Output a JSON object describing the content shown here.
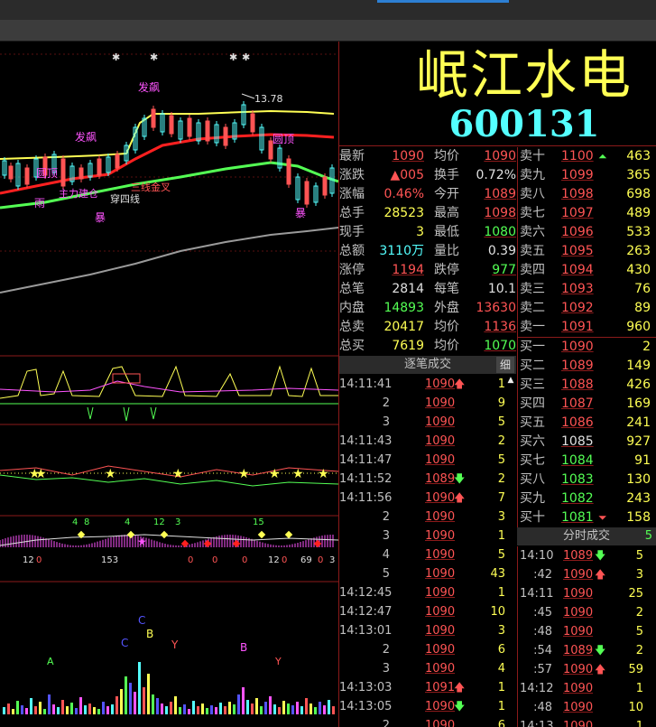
{
  "colors": {
    "up": "#ff5454",
    "down": "#54ff54",
    "volume": "#ffff54",
    "name": "#ffff54",
    "code": "#54ffff",
    "grid": "#8b1a1a"
  },
  "stock": {
    "name": "岷江水电",
    "code": "600131"
  },
  "quote": {
    "rows": [
      {
        "l1": "最新",
        "v1": "1090",
        "c1": "red",
        "u1": true,
        "l2": "均价",
        "v2": "1090",
        "c2": "red",
        "u2": true
      },
      {
        "l1": "涨跌",
        "v1": "▲005",
        "c1": "red",
        "u1": false,
        "l2": "换手",
        "v2": "0.72%",
        "c2": "white",
        "u2": false
      },
      {
        "l1": "涨幅",
        "v1": "0.46%",
        "c1": "red",
        "u1": false,
        "l2": "今开",
        "v2": "1089",
        "c2": "red",
        "u2": true
      },
      {
        "l1": "总手",
        "v1": "28523",
        "c1": "yellow",
        "u1": false,
        "l2": "最高",
        "v2": "1098",
        "c2": "red",
        "u2": true
      },
      {
        "l1": "现手",
        "v1": "3",
        "c1": "yellow",
        "u1": false,
        "l2": "最低",
        "v2": "1080",
        "c2": "green",
        "u2": true
      },
      {
        "l1": "总额",
        "v1": "3110万",
        "c1": "cyan",
        "u1": false,
        "l2": "量比",
        "v2": "0.39",
        "c2": "white",
        "u2": false
      },
      {
        "l1": "涨停",
        "v1": "1194",
        "c1": "red",
        "u1": true,
        "l2": "跌停",
        "v2": "977",
        "c2": "green",
        "u2": true
      },
      {
        "l1": "总笔",
        "v1": "2814",
        "c1": "white",
        "u1": false,
        "l2": "每笔",
        "v2": "10.1",
        "c2": "white",
        "u2": false
      },
      {
        "l1": "内盘",
        "v1": "14893",
        "c1": "green",
        "u1": false,
        "l2": "外盘",
        "v2": "13630",
        "c2": "red",
        "u2": false
      },
      {
        "l1": "总卖",
        "v1": "20417",
        "c1": "yellow",
        "u1": false,
        "l2": "均价",
        "v2": "1136",
        "c2": "red",
        "u2": true
      },
      {
        "l1": "总买",
        "v1": "7619",
        "c1": "yellow",
        "u1": false,
        "l2": "均价",
        "v2": "1070",
        "c2": "green",
        "u2": true
      }
    ]
  },
  "order_book": {
    "asks": [
      {
        "label": "卖十",
        "price": "1100",
        "color": "red",
        "arrow": "⏶",
        "arrow_color": "green",
        "vol": "463"
      },
      {
        "label": "卖九",
        "price": "1099",
        "color": "red",
        "arrow": "",
        "arrow_color": "",
        "vol": "365"
      },
      {
        "label": "卖八",
        "price": "1098",
        "color": "red",
        "arrow": "",
        "arrow_color": "",
        "vol": "698"
      },
      {
        "label": "卖七",
        "price": "1097",
        "color": "red",
        "arrow": "",
        "arrow_color": "",
        "vol": "489"
      },
      {
        "label": "卖六",
        "price": "1096",
        "color": "red",
        "arrow": "",
        "arrow_color": "",
        "vol": "533"
      },
      {
        "label": "卖五",
        "price": "1095",
        "color": "red",
        "arrow": "",
        "arrow_color": "",
        "vol": "263"
      },
      {
        "label": "卖四",
        "price": "1094",
        "color": "red",
        "arrow": "",
        "arrow_color": "",
        "vol": "430"
      },
      {
        "label": "卖三",
        "price": "1093",
        "color": "red",
        "arrow": "",
        "arrow_color": "",
        "vol": "76"
      },
      {
        "label": "卖二",
        "price": "1092",
        "color": "red",
        "arrow": "",
        "arrow_color": "",
        "vol": "89"
      },
      {
        "label": "卖一",
        "price": "1091",
        "color": "red",
        "arrow": "",
        "arrow_color": "",
        "vol": "960"
      }
    ],
    "bids": [
      {
        "label": "买一",
        "price": "1090",
        "color": "red",
        "arrow": "",
        "arrow_color": "",
        "vol": "2"
      },
      {
        "label": "买二",
        "price": "1089",
        "color": "red",
        "arrow": "",
        "arrow_color": "",
        "vol": "149"
      },
      {
        "label": "买三",
        "price": "1088",
        "color": "red",
        "arrow": "",
        "arrow_color": "",
        "vol": "426"
      },
      {
        "label": "买四",
        "price": "1087",
        "color": "red",
        "arrow": "",
        "arrow_color": "",
        "vol": "169"
      },
      {
        "label": "买五",
        "price": "1086",
        "color": "red",
        "arrow": "",
        "arrow_color": "",
        "vol": "241"
      },
      {
        "label": "买六",
        "price": "1085",
        "color": "white",
        "arrow": "",
        "arrow_color": "",
        "vol": "927"
      },
      {
        "label": "买七",
        "price": "1084",
        "color": "green",
        "arrow": "",
        "arrow_color": "",
        "vol": "91"
      },
      {
        "label": "买八",
        "price": "1083",
        "color": "green",
        "arrow": "",
        "arrow_color": "",
        "vol": "130"
      },
      {
        "label": "买九",
        "price": "1082",
        "color": "green",
        "arrow": "",
        "arrow_color": "",
        "vol": "243"
      },
      {
        "label": "买十",
        "price": "1081",
        "color": "green",
        "arrow": "⏷",
        "arrow_color": "red",
        "vol": "158"
      }
    ]
  },
  "tick_section": {
    "title": "逐笔成交",
    "detail_label": "细"
  },
  "ticks": [
    {
      "time": "14:11:41",
      "short": false,
      "price": "1090",
      "arrow": "🡅",
      "arrow_color": "red",
      "vol": "1"
    },
    {
      "time": "2",
      "short": true,
      "price": "1090",
      "arrow": "",
      "arrow_color": "",
      "vol": "9"
    },
    {
      "time": "3",
      "short": true,
      "price": "1090",
      "arrow": "",
      "arrow_color": "",
      "vol": "5"
    },
    {
      "time": "14:11:43",
      "short": false,
      "price": "1090",
      "arrow": "",
      "arrow_color": "",
      "vol": "2"
    },
    {
      "time": "14:11:47",
      "short": false,
      "price": "1090",
      "arrow": "",
      "arrow_color": "",
      "vol": "5"
    },
    {
      "time": "14:11:52",
      "short": false,
      "price": "1089",
      "arrow": "🡇",
      "arrow_color": "green",
      "vol": "2"
    },
    {
      "time": "14:11:56",
      "short": false,
      "price": "1090",
      "arrow": "🡅",
      "arrow_color": "red",
      "vol": "7"
    },
    {
      "time": "2",
      "short": true,
      "price": "1090",
      "arrow": "",
      "arrow_color": "",
      "vol": "3"
    },
    {
      "time": "3",
      "short": true,
      "price": "1090",
      "arrow": "",
      "arrow_color": "",
      "vol": "1"
    },
    {
      "time": "4",
      "short": true,
      "price": "1090",
      "arrow": "",
      "arrow_color": "",
      "vol": "5"
    },
    {
      "time": "5",
      "short": true,
      "price": "1090",
      "arrow": "",
      "arrow_color": "",
      "vol": "43"
    },
    {
      "time": "14:12:45",
      "short": false,
      "price": "1090",
      "arrow": "",
      "arrow_color": "",
      "vol": "1"
    },
    {
      "time": "14:12:47",
      "short": false,
      "price": "1090",
      "arrow": "",
      "arrow_color": "",
      "vol": "10"
    },
    {
      "time": "14:13:01",
      "short": false,
      "price": "1090",
      "arrow": "",
      "arrow_color": "",
      "vol": "3"
    },
    {
      "time": "2",
      "short": true,
      "price": "1090",
      "arrow": "",
      "arrow_color": "",
      "vol": "6"
    },
    {
      "time": "3",
      "short": true,
      "price": "1090",
      "arrow": "",
      "arrow_color": "",
      "vol": "4"
    },
    {
      "time": "14:13:03",
      "short": false,
      "price": "1091",
      "arrow": "🡅",
      "arrow_color": "red",
      "vol": "1"
    },
    {
      "time": "14:13:05",
      "short": false,
      "price": "1090",
      "arrow": "🡇",
      "arrow_color": "green",
      "vol": "1"
    },
    {
      "time": "2",
      "short": true,
      "price": "1090",
      "arrow": "",
      "arrow_color": "",
      "vol": "6"
    }
  ],
  "minute_section": {
    "title": "分时成交",
    "right_glyph": "5"
  },
  "minutes": [
    {
      "time": "14:10",
      "short": false,
      "price": "1089",
      "arrow": "🡇",
      "arrow_color": "green",
      "vol": "5"
    },
    {
      "time": ":42",
      "short": true,
      "price": "1090",
      "arrow": "🡅",
      "arrow_color": "red",
      "vol": "3"
    },
    {
      "time": "14:11",
      "short": false,
      "price": "1090",
      "arrow": "",
      "arrow_color": "",
      "vol": "25"
    },
    {
      "time": ":45",
      "short": true,
      "price": "1090",
      "arrow": "",
      "arrow_color": "",
      "vol": "2"
    },
    {
      "time": ":48",
      "short": true,
      "price": "1090",
      "arrow": "",
      "arrow_color": "",
      "vol": "5"
    },
    {
      "time": ":54",
      "short": true,
      "price": "1089",
      "arrow": "🡇",
      "arrow_color": "green",
      "vol": "2"
    },
    {
      "time": ":57",
      "short": true,
      "price": "1090",
      "arrow": "🡅",
      "arrow_color": "red",
      "vol": "59"
    },
    {
      "time": "14:12",
      "short": false,
      "price": "1090",
      "arrow": "",
      "arrow_color": "",
      "vol": "1"
    },
    {
      "time": ":48",
      "short": true,
      "price": "1090",
      "arrow": "",
      "arrow_color": "",
      "vol": "10"
    },
    {
      "time": "14:13",
      "short": false,
      "price": "1090",
      "arrow": "",
      "arrow_color": "",
      "vol": "1"
    }
  ],
  "chart_labels": {
    "price_marker": "13.78",
    "signal_1": "发飙",
    "signal_2": "发飙",
    "signal_3": "圆顶",
    "signal_4": "圆顶",
    "signal_5": "雨",
    "signal_6": "主力建仓",
    "signal_7": "穿四线",
    "signal_8": "三线金叉",
    "signal_9": "暴",
    "signal_10": "暴",
    "osc_numbers": [
      "4",
      "8",
      "4",
      "12",
      "3",
      "15"
    ],
    "osc_bottom_numbers": [
      "12",
      "0",
      "153",
      "0",
      "0",
      "0",
      "12",
      "0",
      "69",
      "0",
      "3"
    ],
    "vol_letters": [
      "C",
      "B",
      "C",
      "B",
      "Y",
      "A",
      "Y"
    ]
  }
}
